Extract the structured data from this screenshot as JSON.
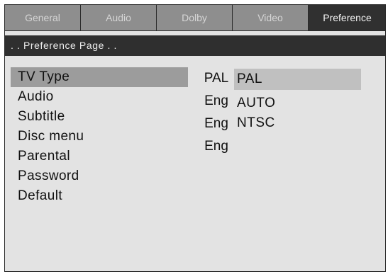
{
  "tabs": [
    {
      "label": "General"
    },
    {
      "label": "Audio"
    },
    {
      "label": "Dolby"
    },
    {
      "label": "Video"
    },
    {
      "label": "Preference",
      "active": true
    }
  ],
  "page_title": ". . Preference Page . .",
  "menu": [
    {
      "label": "TV Type",
      "selected": true
    },
    {
      "label": "Audio"
    },
    {
      "label": "Subtitle"
    },
    {
      "label": "Disc menu"
    },
    {
      "label": "Parental"
    },
    {
      "label": "Password"
    },
    {
      "label": "Default"
    }
  ],
  "current_values": [
    "PAL",
    "Eng",
    "Eng",
    "Eng"
  ],
  "options": [
    {
      "label": "PAL",
      "highlighted": true
    },
    {
      "label": "AUTO"
    },
    {
      "label": "NTSC"
    }
  ],
  "colors": {
    "frame_bg": "#e3e3e3",
    "tab_bg": "#8e8e8e",
    "tab_active_bg": "#303030",
    "page_bar_bg": "#2f2f2f",
    "menu_selected_bg": "#9c9c9c",
    "option_highlight_bg": "#c0c0c0"
  }
}
